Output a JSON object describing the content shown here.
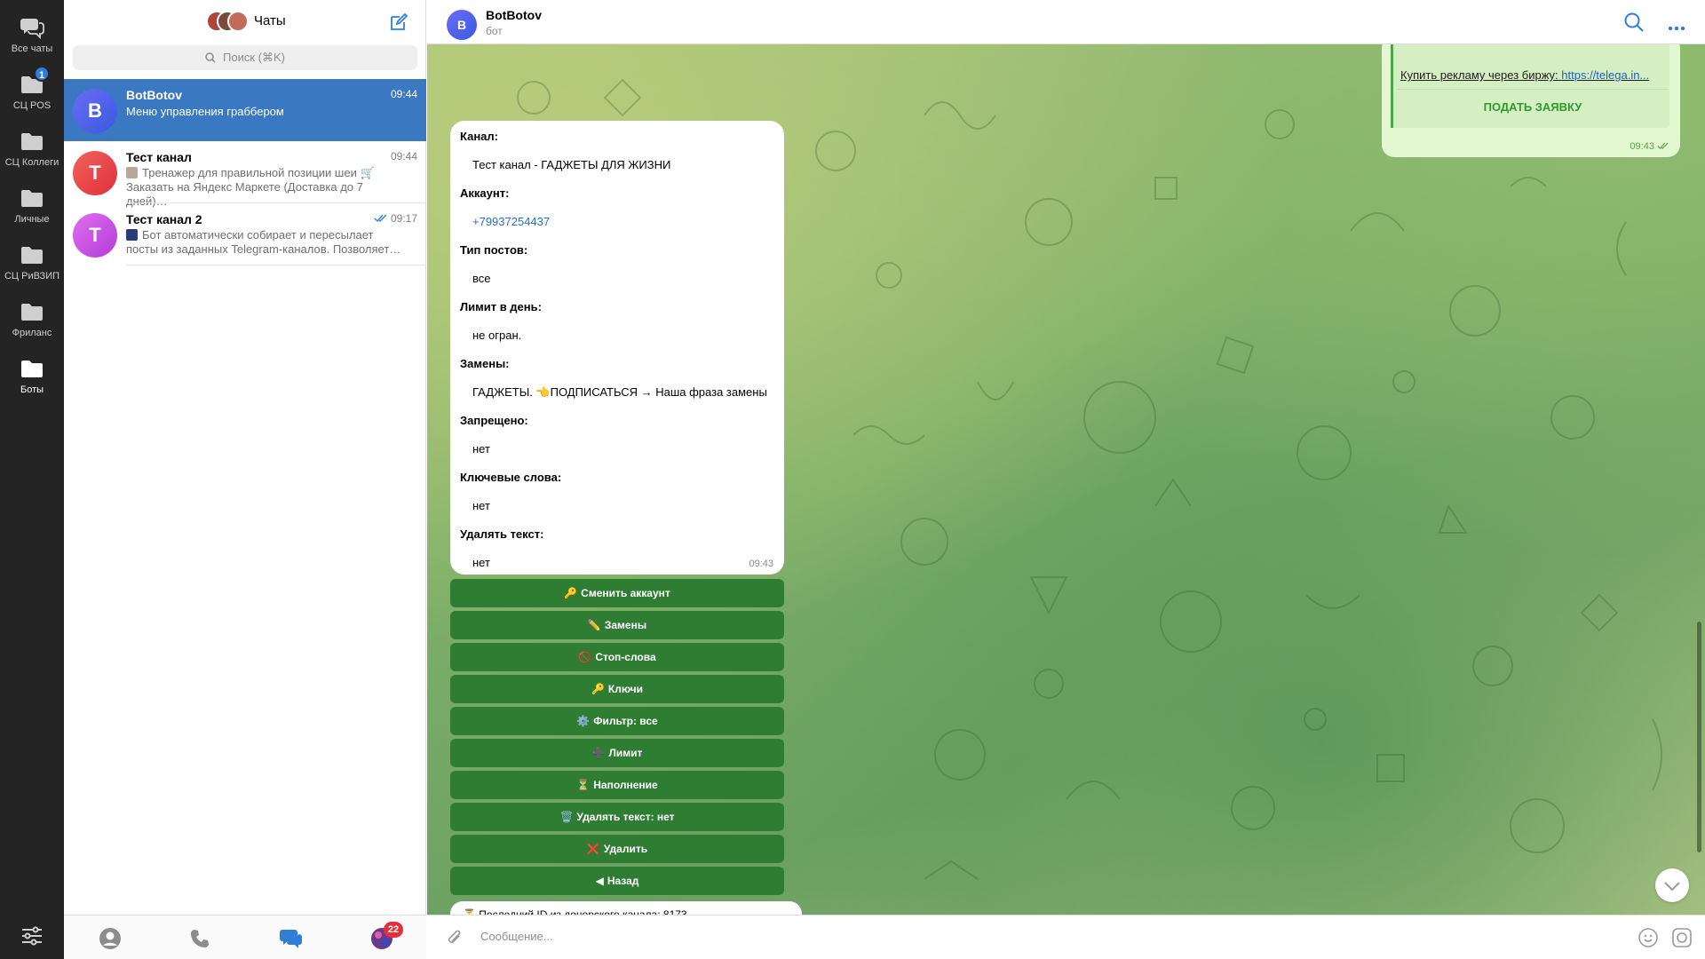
{
  "rail": {
    "folders": [
      {
        "label": "Все чаты",
        "icon": "chat-bubbles-icon",
        "badge": ""
      },
      {
        "label": "СЦ POS",
        "icon": "folder-icon",
        "badge": "1"
      },
      {
        "label": "СЦ Коллеги",
        "icon": "folder-icon",
        "badge": ""
      },
      {
        "label": "Личные",
        "icon": "folder-icon",
        "badge": ""
      },
      {
        "label": "СЦ РиВЗИП",
        "icon": "folder-icon",
        "badge": ""
      },
      {
        "label": "Фриланс",
        "icon": "folder-icon",
        "badge": ""
      },
      {
        "label": "Боты",
        "icon": "folder-icon",
        "badge": ""
      }
    ]
  },
  "list": {
    "title": "Чаты",
    "search_placeholder": "Поиск (⌘K)",
    "chats": [
      {
        "initial": "B",
        "name": "BotBotov",
        "time": "09:44",
        "preview": "Меню управления граббером",
        "color": "#5b5cf0"
      },
      {
        "initial": "T",
        "name": "Тест канал",
        "time": "09:44",
        "preview": "Тренажер для правильной позиции шеи 🛒 Заказать на Яндекс Маркете (Доставка до 7 дней)…",
        "color": "#e8403e"
      },
      {
        "initial": "T",
        "name": "Тест канал 2",
        "time": "09:17",
        "preview": "Бот автоматически собирает и пересылает посты из заданных Telegram-каналов. Позволяет…",
        "color": "#c54be3"
      }
    ],
    "tabs": {
      "calls_badge": "22"
    }
  },
  "chat": {
    "name": "BotBotov",
    "status": "бот",
    "initial": "B",
    "outgoing": {
      "text_prefix": "Купить рекламу через биржу: ",
      "link": "https://telega.in...",
      "button": "ПОДАТЬ ЗАЯВКУ",
      "time": "09:43"
    },
    "incoming": {
      "fields": [
        {
          "label": "Канал:",
          "value": "Тест канал - ГАДЖЕТЫ ДЛЯ ЖИЗНИ"
        },
        {
          "label": "Аккаунт:",
          "value": "+79937254437"
        },
        {
          "label": "Тип постов:",
          "value": "все"
        },
        {
          "label": "Лимит в день:",
          "value": "не огран."
        },
        {
          "label": "Замены:",
          "value": "ГАДЖЕТЫ. 👈ПОДПИСАТЬСЯ → Наша фраза замены"
        },
        {
          "label": "Запрещено:",
          "value": "нет"
        },
        {
          "label": "Ключевые слова:",
          "value": "нет"
        },
        {
          "label": "Удалять текст:",
          "value": "нет"
        }
      ],
      "time": "09:43"
    },
    "keyboard": [
      {
        "emoji": "🔑",
        "label": "Сменить аккаунт"
      },
      {
        "emoji": "✏️",
        "label": "Замены"
      },
      {
        "emoji": "🚫",
        "label": "Стоп-слова"
      },
      {
        "emoji": "🔑",
        "label": "Ключи"
      },
      {
        "emoji": "⚙️",
        "label": "Фильтр: все"
      },
      {
        "emoji": "➕",
        "label": "Лимит"
      },
      {
        "emoji": "⏳",
        "label": "Наполнение"
      },
      {
        "emoji": "🗑️",
        "label": "Удалять текст: нет"
      },
      {
        "emoji": "❌",
        "label": "Удалить"
      },
      {
        "emoji": "◀",
        "label": "Назад"
      }
    ],
    "last_message": "⏳ Последний ID из донорского канала: 8173",
    "composer_placeholder": "Сообщение..."
  }
}
